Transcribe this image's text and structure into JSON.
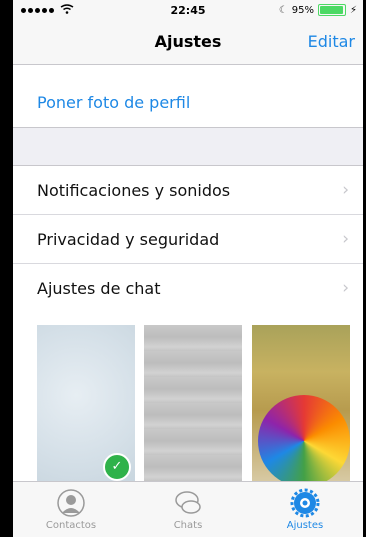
{
  "status_bar": {
    "time": "22:45",
    "battery": "95%",
    "battery_level": 0.95
  },
  "nav": {
    "title": "Ajustes",
    "edit": "Editar"
  },
  "profile": {
    "set_photo": "Poner foto de perfil"
  },
  "settings": [
    {
      "label": "Notificaciones y sonidos"
    },
    {
      "label": "Privacidad y seguridad"
    },
    {
      "label": "Ajustes de chat"
    }
  ],
  "tabs": [
    {
      "label": "Contactos",
      "icon": "contacts-icon"
    },
    {
      "label": "Chats",
      "icon": "chats-icon"
    },
    {
      "label": "Ajustes",
      "icon": "settings-icon"
    }
  ],
  "colors": {
    "accent": "#1e88e5",
    "selected_check": "#2fb24a"
  }
}
